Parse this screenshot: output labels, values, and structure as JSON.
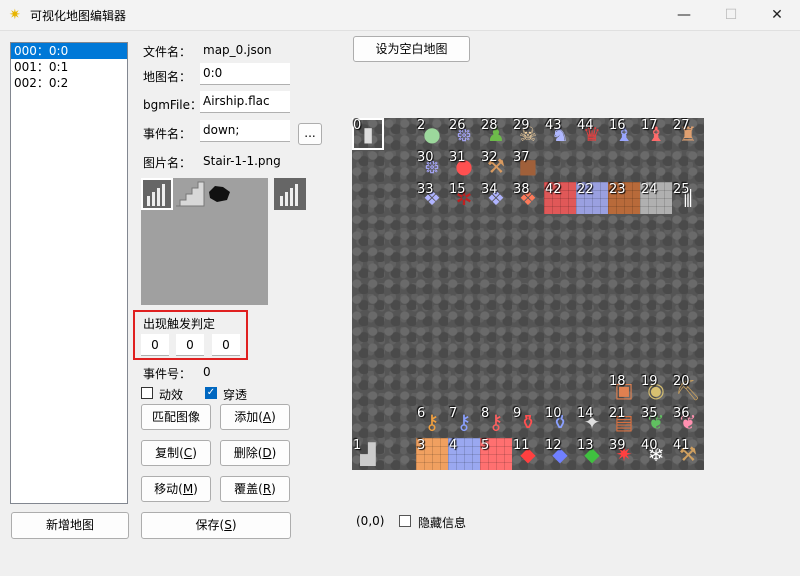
{
  "window": {
    "title": "可视化地图编辑器",
    "minimize": "—",
    "maximize": "☐",
    "close": "✕"
  },
  "map_list": {
    "items": [
      "000：0:0",
      "001：0:1",
      "002：0:2"
    ],
    "selected_index": 0
  },
  "fields": {
    "filename_label": "文件名：",
    "filename_value": "map_0.json",
    "mapname_label": "地图名：",
    "mapname_value": "0:0",
    "bgm_label": "bgmFile：",
    "bgm_value": "Airship.flac",
    "event_label": "事件名：",
    "event_value": "down;",
    "event_browse": "...",
    "image_label": "图片名：",
    "image_value": "Stair-1-1.png"
  },
  "trigger": {
    "label": "出现触发判定",
    "values": [
      "0",
      "0",
      "0"
    ]
  },
  "event_num": {
    "label": "事件号：",
    "value": "0"
  },
  "checkboxes": {
    "animate_label": "动效",
    "animate_checked": false,
    "passthrough_label": "穿透",
    "passthrough_checked": true
  },
  "buttons": {
    "match_image": "匹配图像",
    "add": "添加(",
    "add_key": "A",
    "copy": "复制(",
    "copy_key": "C",
    "delete": "删除(",
    "delete_key": "D",
    "move": "移动(",
    "move_key": "M",
    "cover": "覆盖(",
    "cover_key": "R",
    "close_paren": ")",
    "new_map": "新增地图",
    "save": "保存(",
    "save_key": "S",
    "set_blank": "设为空白地图"
  },
  "status": {
    "coords": "(0,0)",
    "hide_info_label": "隐藏信息",
    "hide_info_checked": false
  },
  "map_cells": [
    {
      "n": "0",
      "c": 0,
      "r": 0,
      "icon": "wall-bars-icon",
      "glyph": "▮",
      "color": "#ddd"
    },
    {
      "n": "2",
      "c": 2,
      "r": 0,
      "icon": "green-slime-icon",
      "glyph": "●",
      "color": "#9cd89c"
    },
    {
      "n": "26",
      "c": 3,
      "r": 0,
      "icon": "bat-icon",
      "glyph": "᪥",
      "color": "#a8a8ff"
    },
    {
      "n": "28",
      "c": 4,
      "r": 0,
      "icon": "zombie-icon",
      "glyph": "♟",
      "color": "#6dbb4a"
    },
    {
      "n": "29",
      "c": 5,
      "r": 0,
      "icon": "skeleton-icon",
      "glyph": "☠",
      "color": "#f0d0a0"
    },
    {
      "n": "43",
      "c": 6,
      "r": 0,
      "icon": "ghost-icon",
      "glyph": "♞",
      "color": "#b0b8ff"
    },
    {
      "n": "44",
      "c": 7,
      "r": 0,
      "icon": "red-knight-icon",
      "glyph": "♛",
      "color": "#e04040"
    },
    {
      "n": "16",
      "c": 8,
      "r": 0,
      "icon": "wizard-icon",
      "glyph": "♝",
      "color": "#9aa6ff"
    },
    {
      "n": "17",
      "c": 9,
      "r": 0,
      "icon": "red-priest-icon",
      "glyph": "♝",
      "color": "#ff6b6b"
    },
    {
      "n": "27",
      "c": 10,
      "r": 0,
      "icon": "merchant-icon",
      "glyph": "♜",
      "color": "#e0a070"
    },
    {
      "n": "30",
      "c": 2,
      "r": 1,
      "icon": "bat-icon",
      "glyph": "᪥",
      "color": "#a8a8ff"
    },
    {
      "n": "31",
      "c": 3,
      "r": 1,
      "icon": "red-slime-icon",
      "glyph": "●",
      "color": "#ff5050"
    },
    {
      "n": "32",
      "c": 4,
      "r": 1,
      "icon": "pickaxe-icon",
      "glyph": "⚒",
      "color": "#d89a60"
    },
    {
      "n": "37",
      "c": 5,
      "r": 1,
      "icon": "golem-icon",
      "glyph": "■",
      "color": "#a0603a"
    },
    {
      "n": "33",
      "c": 2,
      "r": 2,
      "icon": "ice-block-icon",
      "glyph": "❖",
      "color": "#b0b4ff"
    },
    {
      "n": "15",
      "c": 3,
      "r": 2,
      "icon": "red-trap-icon",
      "glyph": "✲",
      "color": "#c02020"
    },
    {
      "n": "34",
      "c": 4,
      "r": 2,
      "icon": "ice-block-icon",
      "glyph": "❖",
      "color": "#b0b4ff"
    },
    {
      "n": "38",
      "c": 5,
      "r": 2,
      "icon": "lava-block-icon",
      "glyph": "❖",
      "color": "#ff7a5a"
    },
    {
      "n": "42",
      "c": 6,
      "r": 2,
      "icon": "red-wall-icon",
      "glyph": "",
      "color": "#e05858"
    },
    {
      "n": "22",
      "c": 7,
      "r": 2,
      "icon": "blue-brick-icon",
      "glyph": "",
      "color": "#9aa0e0"
    },
    {
      "n": "23",
      "c": 8,
      "r": 2,
      "icon": "brown-brick-icon",
      "glyph": "",
      "color": "#b86a3a"
    },
    {
      "n": "24",
      "c": 9,
      "r": 2,
      "icon": "grey-brick-icon",
      "glyph": "",
      "color": "#b0b0b0"
    },
    {
      "n": "25",
      "c": 10,
      "r": 2,
      "icon": "fence-icon",
      "glyph": "⫼",
      "color": "#ffffff"
    },
    {
      "n": "18",
      "c": 8,
      "r": 8,
      "icon": "gift-box-icon",
      "glyph": "▣",
      "color": "#e08050"
    },
    {
      "n": "19",
      "c": 9,
      "r": 8,
      "icon": "coin-icon",
      "glyph": "◉",
      "color": "#d8c070"
    },
    {
      "n": "20",
      "c": 10,
      "r": 8,
      "icon": "pickaxe-icon",
      "glyph": "⛏",
      "color": "#c8a060"
    },
    {
      "n": "6",
      "c": 2,
      "r": 9,
      "icon": "yellow-key-icon",
      "glyph": "⚷",
      "color": "#f0a040"
    },
    {
      "n": "7",
      "c": 3,
      "r": 9,
      "icon": "blue-key-icon",
      "glyph": "⚷",
      "color": "#8aa0ff"
    },
    {
      "n": "8",
      "c": 4,
      "r": 9,
      "icon": "red-key-icon",
      "glyph": "⚷",
      "color": "#ff6060"
    },
    {
      "n": "9",
      "c": 5,
      "r": 9,
      "icon": "red-potion-icon",
      "glyph": "⚱",
      "color": "#ff5050"
    },
    {
      "n": "10",
      "c": 6,
      "r": 9,
      "icon": "blue-potion-icon",
      "glyph": "⚱",
      "color": "#8aa0ff"
    },
    {
      "n": "14",
      "c": 7,
      "r": 9,
      "icon": "gem-icon",
      "glyph": "✦",
      "color": "#e0e0e0"
    },
    {
      "n": "21",
      "c": 8,
      "r": 9,
      "icon": "book-icon",
      "glyph": "▤",
      "color": "#d87040"
    },
    {
      "n": "35",
      "c": 9,
      "r": 9,
      "icon": "green-bag-icon",
      "glyph": "❦",
      "color": "#60c060"
    },
    {
      "n": "36",
      "c": 10,
      "r": 9,
      "icon": "pink-bag-icon",
      "glyph": "❦",
      "color": "#ff90b0"
    },
    {
      "n": "1",
      "c": 0,
      "r": 10,
      "icon": "stair-icon",
      "glyph": "▟",
      "color": "#ccc"
    },
    {
      "n": "3",
      "c": 2,
      "r": 10,
      "icon": "yellow-door-icon",
      "glyph": "",
      "color": "#f0a060"
    },
    {
      "n": "4",
      "c": 3,
      "r": 10,
      "icon": "blue-door-icon",
      "glyph": "",
      "color": "#9aa8f0"
    },
    {
      "n": "5",
      "c": 4,
      "r": 10,
      "icon": "red-door-icon",
      "glyph": "",
      "color": "#ff7070"
    },
    {
      "n": "11",
      "c": 5,
      "r": 10,
      "icon": "red-gem-icon",
      "glyph": "◆",
      "color": "#ff4040"
    },
    {
      "n": "12",
      "c": 6,
      "r": 10,
      "icon": "blue-gem-icon",
      "glyph": "◆",
      "color": "#7080ff"
    },
    {
      "n": "13",
      "c": 7,
      "r": 10,
      "icon": "green-gem-icon",
      "glyph": "◆",
      "color": "#40c040"
    },
    {
      "n": "39",
      "c": 8,
      "r": 10,
      "icon": "dynamite-icon",
      "glyph": "✷",
      "color": "#ff4040"
    },
    {
      "n": "40",
      "c": 9,
      "r": 10,
      "icon": "snowflake-icon",
      "glyph": "❄",
      "color": "#ffffff"
    },
    {
      "n": "41",
      "c": 10,
      "r": 10,
      "icon": "hammer-icon",
      "glyph": "⚒",
      "color": "#d0a060"
    }
  ]
}
